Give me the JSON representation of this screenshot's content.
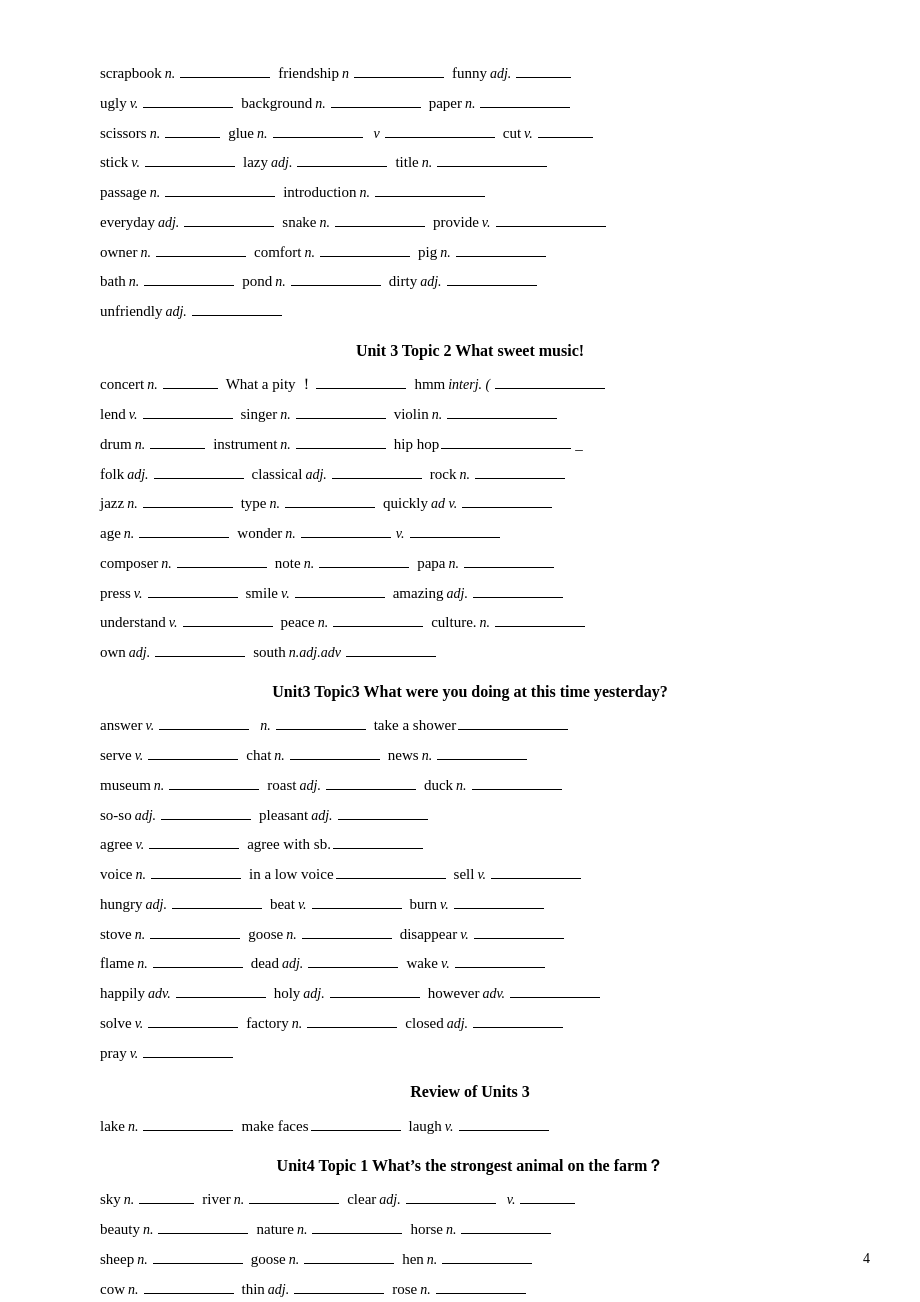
{
  "page": "4",
  "sections": [
    {
      "lines": [
        "scrapbook n. ___ friendship n.___ funny adj.___",
        "ugly v. ___ background n.___ paper n.___",
        "scissors n. ___ glue n.___ v.___ cut v.___",
        "stick v. ___ lazy adj.___ title n.___",
        "passage n. ___ introduction n.___",
        "everyday adj.___ snake n.___ provide v.___",
        "owner n.___ comfort n.___ pig n.___",
        "bath n.___ pond n.___ dirty adj.___",
        "unfriendly adj.___"
      ]
    }
  ],
  "unit3_topic2_title": "Unit 3  Topic 2  What sweet music!",
  "unit3_topic3_title": "Unit3 Topic3 What were you doing at  this  time  yesterday?",
  "review_title": "Review of Units 3",
  "unit4_topic1_title": "Unit4 Topic 1 What’s the strongest animal on the farm？"
}
